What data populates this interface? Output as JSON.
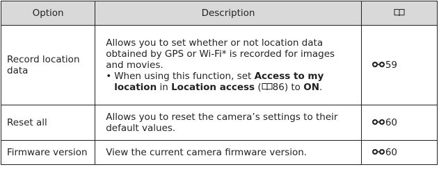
{
  "table": {
    "headers": {
      "option": "Option",
      "description": "Description",
      "ref_icon": "book-reference-icon"
    },
    "rows": [
      {
        "option": "Record location data",
        "description": "Allows you to set whether or not location data obtained by GPS or Wi-Fi* is recorded for images and movies.",
        "bullet": "•",
        "note_pre": "When using this function, set ",
        "note_bold1": "Access to my location",
        "note_mid1": " in ",
        "note_bold2": "Location access",
        "note_paren_open": " (",
        "note_page": "86",
        "note_paren_close": ") to ",
        "note_bold3": "ON",
        "note_end": ".",
        "ref_page": "59"
      },
      {
        "option": "Reset all",
        "description": "Allows you to reset the camera’s settings to their default values.",
        "ref_page": "60"
      },
      {
        "option": "Firmware version",
        "description": "View the current camera firmware version.",
        "ref_page": "60"
      }
    ]
  }
}
